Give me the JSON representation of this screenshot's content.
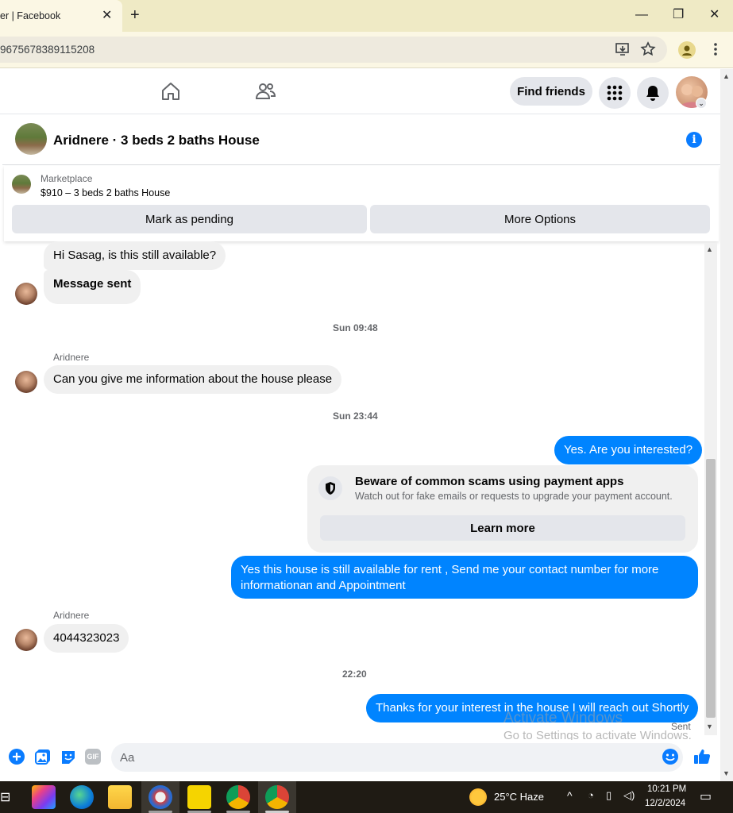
{
  "browser": {
    "tab_title": "er | Facebook",
    "tab_close": "✕",
    "new_tab": "+",
    "url": "9675678389115208",
    "window_minimize": "—",
    "window_restore": "❐",
    "window_close": "✕"
  },
  "header": {
    "find_friends": "Find friends"
  },
  "conversation": {
    "title": "Aridnere · 3 beds 2 baths House",
    "info_icon": "i"
  },
  "listing": {
    "label": "Marketplace",
    "price_title": "$910 – 3 beds 2 baths House",
    "mark_pending": "Mark as pending",
    "more_options": "More Options"
  },
  "messages": {
    "m1": "Hi Sasag, is this still available?",
    "m2": "Message sent",
    "ts1": "Sun 09:48",
    "sender1": "Aridnere",
    "m3": "Can you give me information  about the house please",
    "ts2": "Sun 23:44",
    "m4": "Yes. Are you interested?",
    "scam_title": "Beware of common scams using payment apps",
    "scam_sub": "Watch out for fake emails or requests to upgrade your payment account.",
    "learn_more": "Learn more",
    "m5_line1": "Yes this house is still available for rent , Send me your contact number for more",
    "m5_line2": "informationan and Appointment",
    "sender2": "Aridnere",
    "m6": "4044323023",
    "ts3": "22:20",
    "m7": "Thanks for your interest in the house I will reach out Shortly",
    "sent": "Sent"
  },
  "watermark": {
    "line1": "Activate Windows",
    "line2": "Go to Settings to activate Windows."
  },
  "composer": {
    "placeholder": "Aa",
    "gif_label": "GIF"
  },
  "taskbar": {
    "weather": "25°C  Haze",
    "time": "10:21 PM",
    "date": "12/2/2024"
  },
  "colors": {
    "messenger_blue": "#0084ff",
    "facebook_blue": "#0a7cff",
    "bubble_gray": "#f0f0f0"
  }
}
